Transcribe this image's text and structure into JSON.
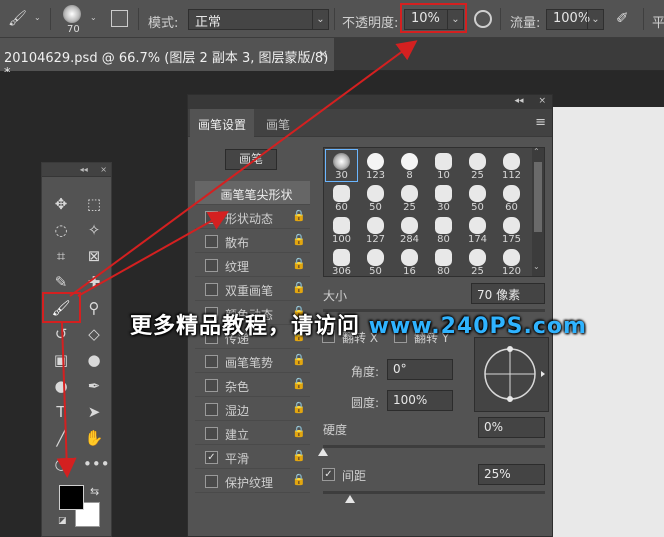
{
  "options_bar": {
    "brush_size": "70",
    "mode_label": "模式:",
    "mode_value": "正常",
    "opacity_label": "不透明度:",
    "opacity_value": "10%",
    "flow_label": "流量:",
    "flow_value": "100%",
    "pressure_label": "平"
  },
  "document_tab": {
    "title": "20104629.psd @ 66.7% (图层 2 副本 3, 图层蒙版/8) *",
    "close": "×"
  },
  "toolbar": {
    "header_glyph": "◂◂",
    "close_glyph": "×",
    "tools": [
      {
        "name": "move-tool",
        "glyph": "✥"
      },
      {
        "name": "marquee-tool",
        "glyph": "⬚"
      },
      {
        "name": "lasso-tool",
        "glyph": "◌"
      },
      {
        "name": "magic-wand-tool",
        "glyph": "✧"
      },
      {
        "name": "crop-tool",
        "glyph": "⌗"
      },
      {
        "name": "frame-tool",
        "glyph": "⊠"
      },
      {
        "name": "eyedropper-tool",
        "glyph": "✎"
      },
      {
        "name": "healing-tool",
        "glyph": "✚"
      },
      {
        "name": "brush-tool",
        "glyph": "🖌"
      },
      {
        "name": "stamp-tool",
        "glyph": "⚲"
      },
      {
        "name": "history-brush-tool",
        "glyph": "↺"
      },
      {
        "name": "eraser-tool",
        "glyph": "◇"
      },
      {
        "name": "gradient-tool",
        "glyph": "▣"
      },
      {
        "name": "blur-tool",
        "glyph": "●"
      },
      {
        "name": "dodge-tool",
        "glyph": "●"
      },
      {
        "name": "pen-tool",
        "glyph": "✒"
      },
      {
        "name": "type-tool",
        "glyph": "T"
      },
      {
        "name": "path-select-tool",
        "glyph": "➤"
      },
      {
        "name": "line-tool",
        "glyph": "╱"
      },
      {
        "name": "hand-tool",
        "glyph": "✋"
      },
      {
        "name": "zoom-tool",
        "glyph": "○"
      },
      {
        "name": "more-tools",
        "glyph": "•••"
      }
    ]
  },
  "brush_panel": {
    "top_glyph": "◂◂",
    "close_glyph": "×",
    "tab_settings": "画笔设置",
    "tab_brush": "画笔",
    "menu_glyph": "≡",
    "preset_button": "画笔",
    "tip_shape": "画笔笔尖形状",
    "options": [
      {
        "label": "形状动态",
        "checked": false
      },
      {
        "label": "散布",
        "checked": false
      },
      {
        "label": "纹理",
        "checked": false
      },
      {
        "label": "双重画笔",
        "checked": false
      },
      {
        "label": "颜色动态",
        "checked": false
      },
      {
        "label": "传递",
        "checked": false
      },
      {
        "label": "画笔笔势",
        "checked": false
      },
      {
        "label": "杂色",
        "checked": false
      },
      {
        "label": "湿边",
        "checked": false
      },
      {
        "label": "建立",
        "checked": false
      },
      {
        "label": "平滑",
        "checked": true
      },
      {
        "label": "保护纹理",
        "checked": false
      }
    ],
    "brush_sizes": [
      "30",
      "123",
      "8",
      "10",
      "25",
      "112",
      "60",
      "50",
      "25",
      "30",
      "50",
      "60",
      "100",
      "127",
      "284",
      "80",
      "174",
      "175",
      "306",
      "50",
      "16",
      "80",
      "25",
      "120"
    ],
    "size_label": "大小",
    "size_value": "70 像素",
    "flip_x": "翻转 X",
    "flip_y": "翻转 Y",
    "angle_label": "角度:",
    "angle_value": "0°",
    "roundness_label": "圆度:",
    "roundness_value": "100%",
    "hardness_label": "硬度",
    "hardness_value": "0%",
    "spacing_label": "间距",
    "spacing_value": "25%",
    "spacing_checked": true,
    "check_glyph": "✓",
    "lock_glyph": "🔒"
  },
  "watermark": {
    "text": "更多精品教程，请访问 ",
    "url": "www.240PS.com"
  },
  "colors": {
    "annotation": "#d42020",
    "watermark_url": "#2fb3ff",
    "panel_bg": "#535353"
  }
}
